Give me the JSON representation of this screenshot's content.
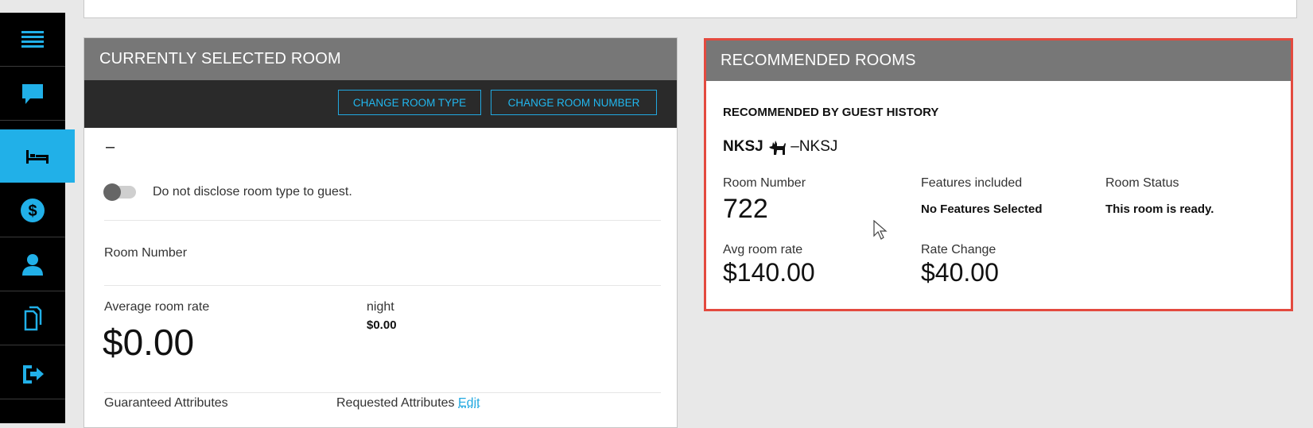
{
  "sidebar": {
    "items": [
      {
        "icon": "menu-icon"
      },
      {
        "icon": "chat-icon"
      },
      {
        "icon": "bed-icon",
        "active": true
      },
      {
        "icon": "dollar-icon"
      },
      {
        "icon": "person-icon"
      },
      {
        "icon": "documents-icon"
      },
      {
        "icon": "checkout-icon"
      }
    ],
    "accent": "#21b0e8"
  },
  "selected_room": {
    "header": "CURRENTLY SELECTED ROOM",
    "change_room_type": "CHANGE ROOM TYPE",
    "change_room_number": "CHANGE ROOM NUMBER",
    "room_type_placeholder": "–",
    "disclose_toggle_label": "Do not disclose room type to guest.",
    "room_number_label": "Room Number",
    "avg_rate_label": "Average room rate",
    "avg_rate_value": "$0.00",
    "night_label": "night",
    "night_value": "$0.00",
    "guaranteed_label": "Guaranteed Attributes",
    "requested_label": "Requested Attributes",
    "edit_link": "Edit"
  },
  "recommended": {
    "header": "RECOMMENDED ROOMS",
    "subtitle": "RECOMMENDED BY GUEST HISTORY",
    "room_code": "NKSJ",
    "room_code_suffix": "–NKSJ",
    "room_number_label": "Room Number",
    "room_number_value": "722",
    "features_label": "Features included",
    "features_value": "No Features Selected",
    "status_label": "Room Status",
    "status_value": "This room is ready.",
    "avg_rate_label": "Avg room rate",
    "avg_rate_value": "$140.00",
    "rate_change_label": "Rate Change",
    "rate_change_value": "$40.00",
    "border_color": "#e34a3f"
  }
}
